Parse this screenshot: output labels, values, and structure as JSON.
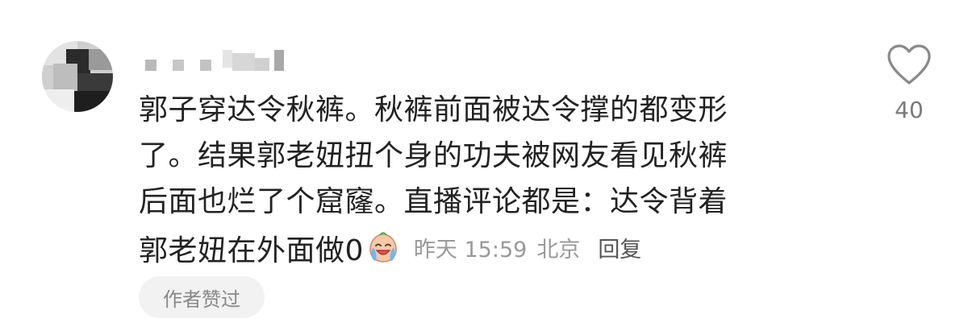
{
  "comment": {
    "body_lines": [
      "郭子穿达令秋裤。秋裤前面被达令撑的都变形",
      "了。结果郭老妞扭个身的功夫被网友看见秋裤",
      "后面也烂了个窟窿。直播评论都是：达令背着"
    ],
    "tail_text": "郭老妞在外面做0",
    "emoji_icon": "laugh-cry-emoji-icon",
    "time": "昨天 15:59",
    "location": "北京",
    "reply_label": "回复",
    "author_badge": "作者赞过",
    "like_count": "40",
    "like_icon": "heart-outline-icon"
  },
  "colors": {
    "text": "#222222",
    "meta": "#9a9a9a",
    "reply": "#555555",
    "badge_bg": "#f2f2f2",
    "badge_text": "#888888",
    "like": "#7a7a7a"
  }
}
